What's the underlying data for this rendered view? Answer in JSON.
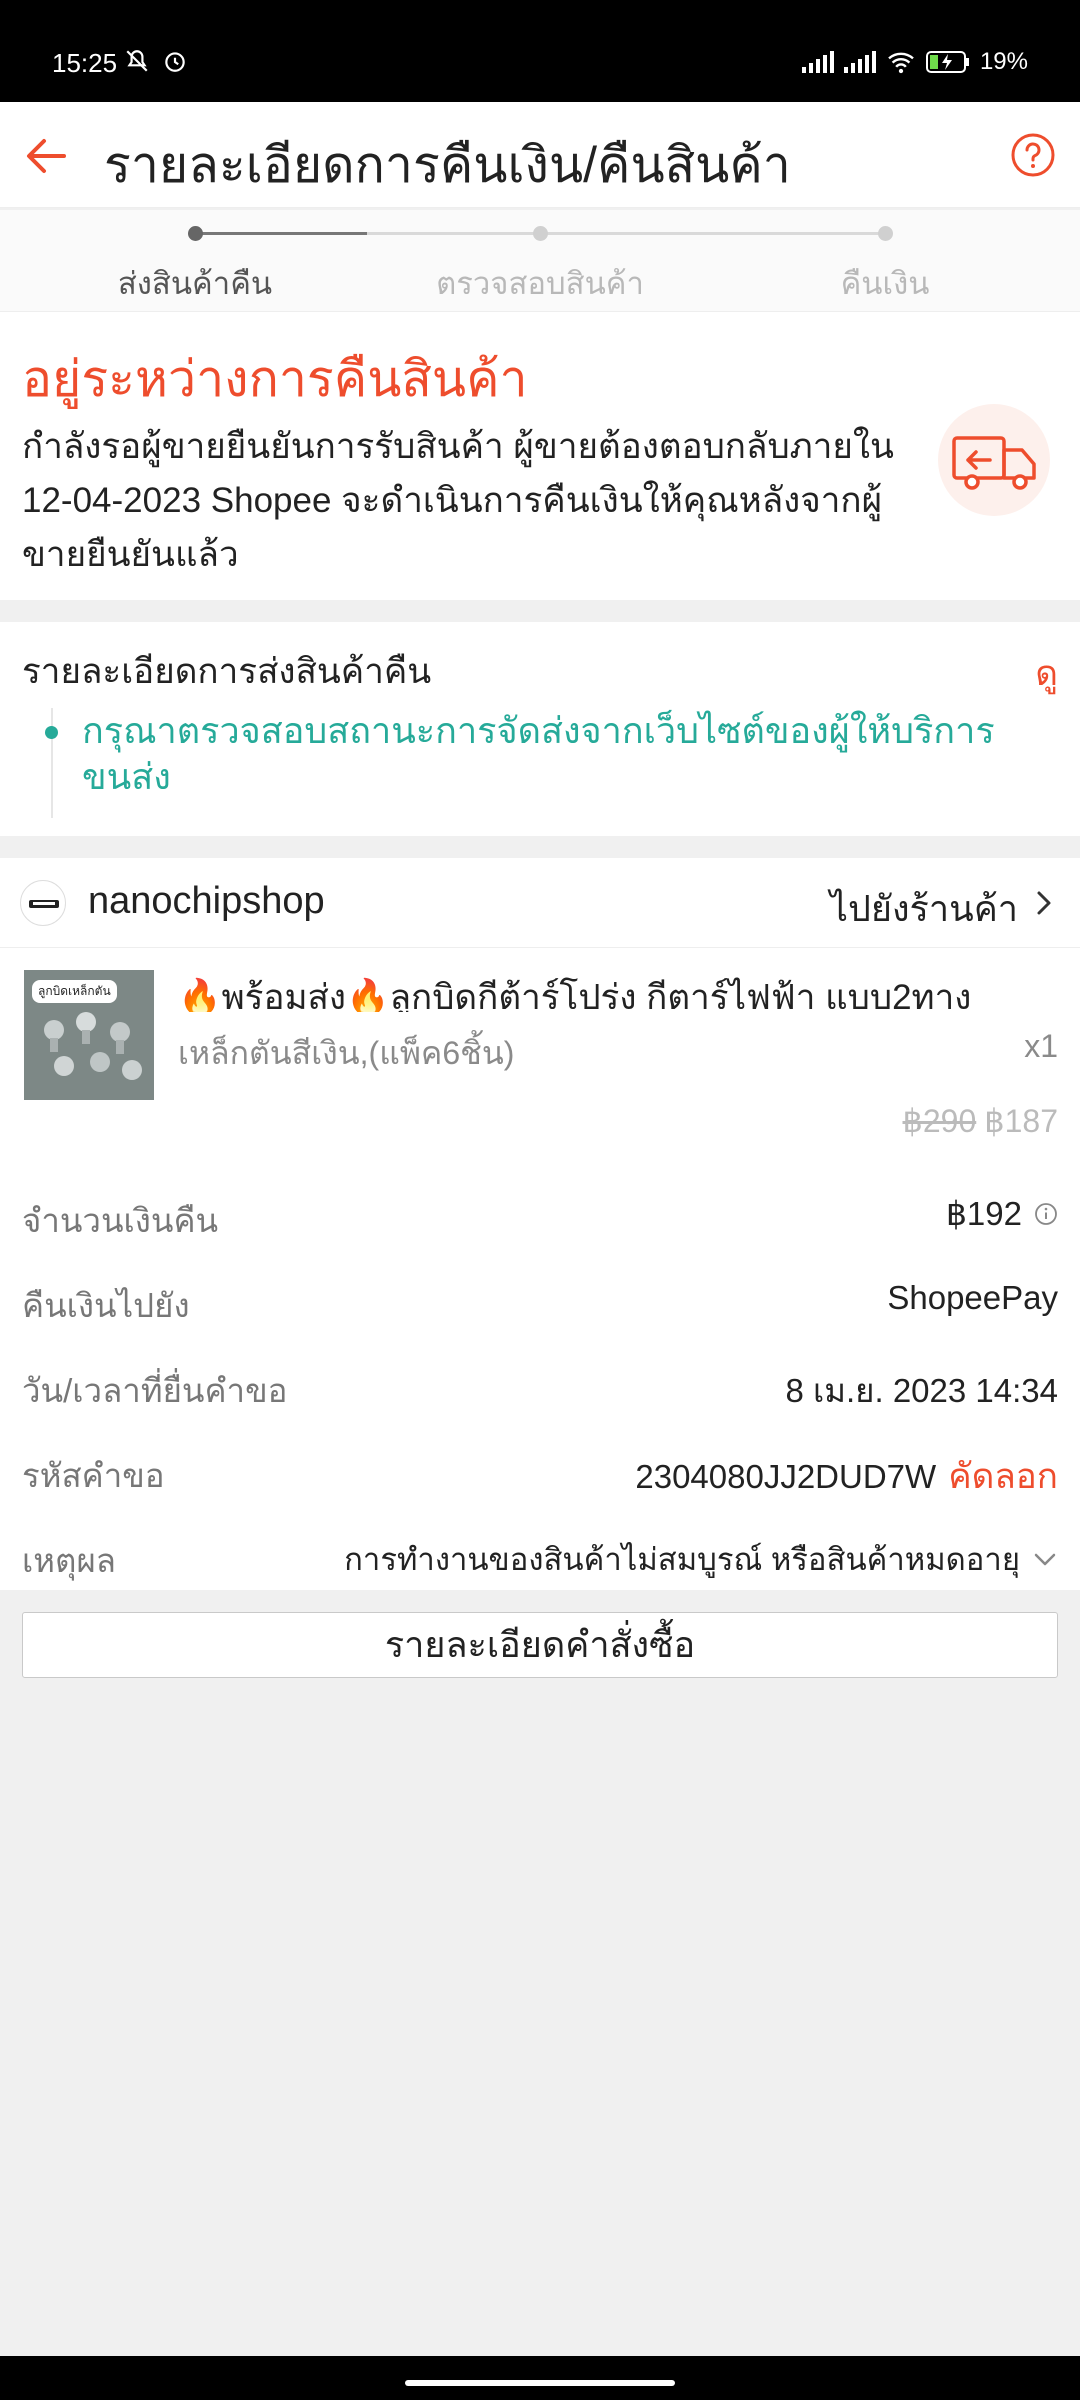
{
  "status_bar": {
    "time": "15:25",
    "battery": "19%"
  },
  "app_bar": {
    "title": "รายละเอียดการคืนเงิน/คืนสินค้า"
  },
  "stepper": {
    "steps": [
      {
        "label": "ส่งสินค้าคืน",
        "active": true
      },
      {
        "label": "ตรวจสอบสินค้า",
        "active": false
      },
      {
        "label": "คืนเงิน",
        "active": false
      }
    ]
  },
  "status": {
    "heading": "อยู่ระหว่างการคืนสินค้า",
    "description": "กำลังรอผู้ขายยืนยันการรับสินค้า ผู้ขายต้องตอบกลับภายใน 12-04-2023 Shopee จะดำเนินการคืนเงินให้คุณหลังจากผู้ขายยืนยันแล้ว"
  },
  "shipping": {
    "label": "รายละเอียดการส่งสินค้าคืน",
    "view_label": "ดู",
    "message": "กรุณาตรวจสอบสถานะการจัดส่งจากเว็บไซต์ของผู้ให้บริการขนส่ง"
  },
  "shop": {
    "name": "nanochipshop",
    "goto_label": "ไปยังร้านค้า"
  },
  "product": {
    "name": "🔥พร้อมส่ง🔥ลูกบิดกีต้าร์โปร่ง กีตาร์ไฟฟ้า แบบ2ทาง",
    "thumb_tag": "ลูกบิดเหล็กตัน",
    "variant": "เหล็กตันสีเงิน,(แพ็ค6ชิ้น)",
    "quantity": "x1",
    "original_price": "฿290",
    "price": "฿187"
  },
  "details": {
    "refund_amount": {
      "label": "จำนวนเงินคืน",
      "value": "฿192"
    },
    "refund_to": {
      "label": "คืนเงินไปยัง",
      "value": "ShopeePay"
    },
    "request_time": {
      "label": "วัน/เวลาที่ยื่นคำขอ",
      "value": "8 เม.ย. 2023 14:34"
    },
    "request_id": {
      "label": "รหัสคำขอ",
      "value": "2304080JJ2DUD7W",
      "copy_label": "คัดลอก"
    },
    "reason": {
      "label": "เหตุผล",
      "value": "การทำงานของสินค้าไม่สมบูรณ์ หรือสินค้าหมดอายุ"
    }
  },
  "order_details_button": "รายละเอียดคำสั่งซื้อ",
  "colors": {
    "accent": "#ee4d2d",
    "teal": "#26aa99"
  }
}
